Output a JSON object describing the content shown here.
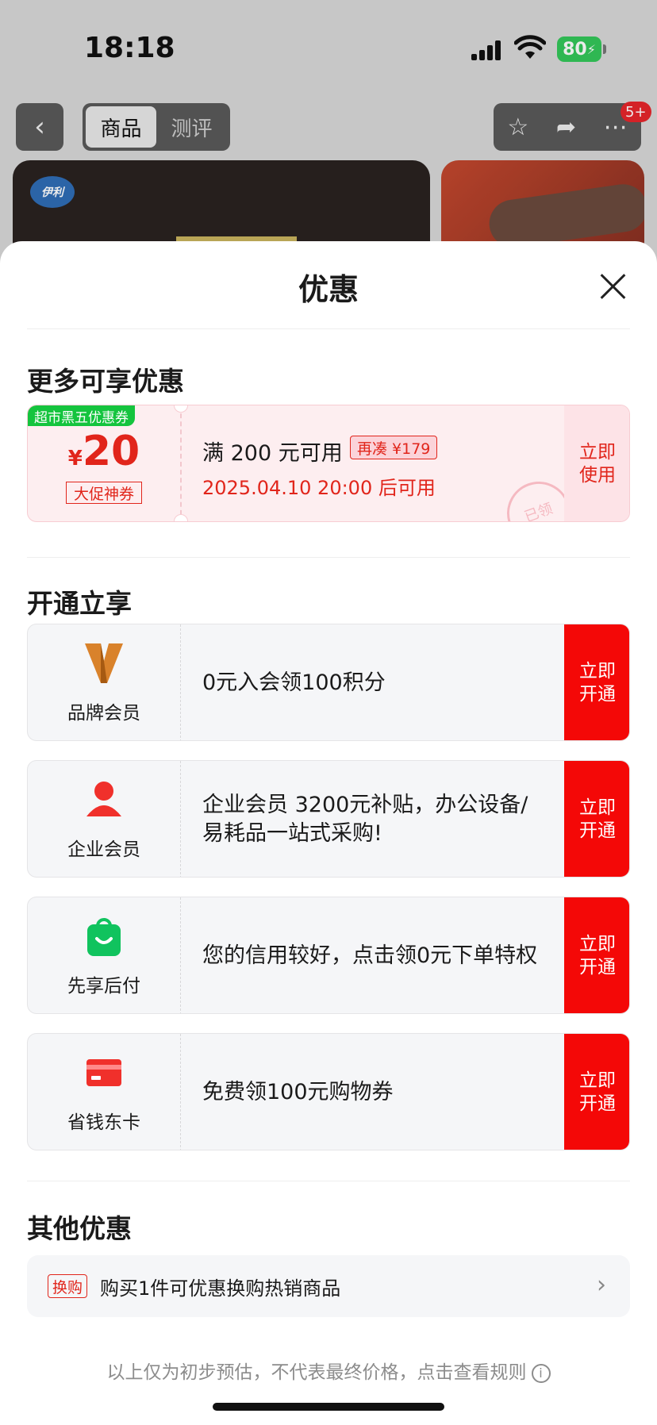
{
  "status_bar": {
    "time": "18:18",
    "battery": "80"
  },
  "nav": {
    "back_icon": "chevron-left-icon",
    "tabs": [
      {
        "label": "商品",
        "active": true
      },
      {
        "label": "测评",
        "active": false
      }
    ],
    "actions": [
      "star-icon",
      "share-icon",
      "more-icon"
    ],
    "badge": "5+"
  },
  "product": {
    "brand_logo": "伊利"
  },
  "sheet": {
    "title": "优惠",
    "section_more": "更多可享优惠",
    "coupon": {
      "tag": "超市黑五优惠券",
      "currency": "¥",
      "amount": "20",
      "subtitle": "大促神券",
      "condition": "满 200 元可用",
      "extra": "再凑 ¥179",
      "time": "2025.04.10 20:00 后可用",
      "stamp": "已领",
      "action": "立即使用"
    },
    "section_open": "开通立享",
    "memberships": [
      {
        "icon": "brand-v-icon",
        "name": "品牌会员",
        "text": "0元入会领100积分",
        "action": "立即开通"
      },
      {
        "icon": "person-icon",
        "name": "企业会员",
        "text": "企业会员 3200元补贴，办公设备/易耗品一站式采购!",
        "action": "立即开通"
      },
      {
        "icon": "shopping-bag-icon",
        "name": "先享后付",
        "text": "您的信用较好，点击领0元下单特权",
        "action": "立即开通"
      },
      {
        "icon": "card-icon",
        "name": "省钱东卡",
        "text": "免费领100元购物券",
        "action": "立即开通"
      }
    ],
    "section_other": "其他优惠",
    "other": {
      "tag": "换购",
      "text": "购买1件可优惠换购热销商品"
    },
    "footer": "以上仅为初步预估，不代表最终价格，点击查看规则",
    "colors": {
      "accent": "#f40807",
      "coupon_red": "#e1251b",
      "coupon_bg": "#fdeef0",
      "tag_green": "#14c43e"
    }
  }
}
